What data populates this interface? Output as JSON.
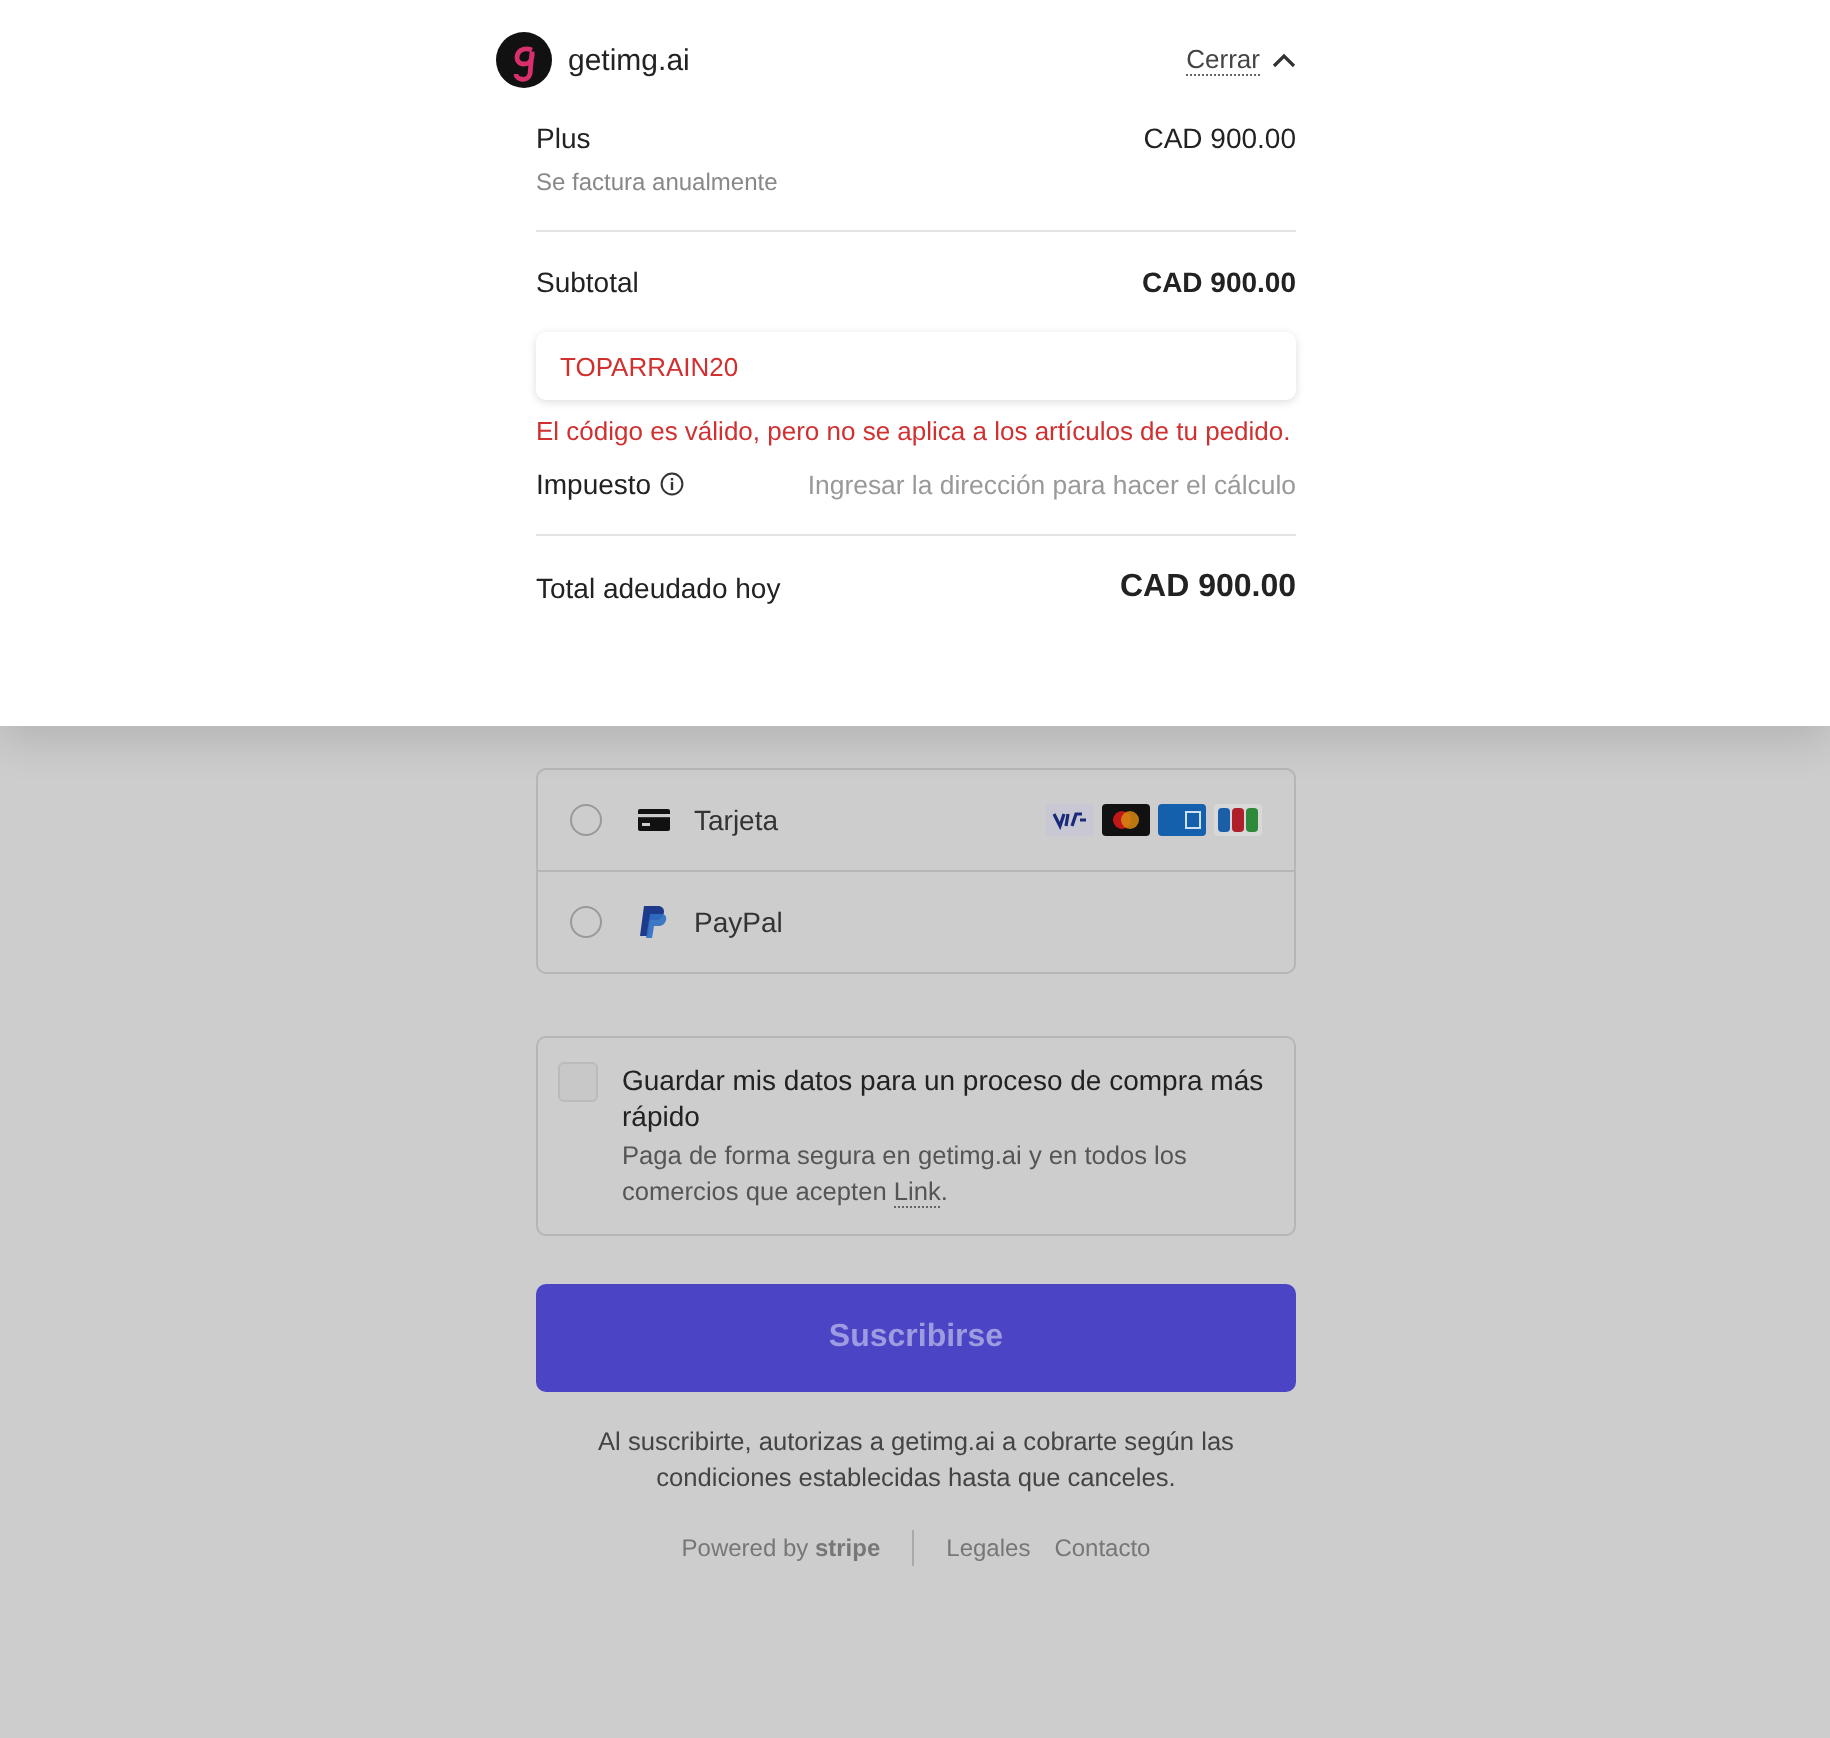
{
  "header": {
    "brand": "getimg.ai",
    "close_label": "Cerrar"
  },
  "line_items": [
    {
      "name": "Plus",
      "note": "Se factura anualmente",
      "amount": "CAD 900.00"
    }
  ],
  "subtotal": {
    "label": "Subtotal",
    "amount": "CAD 900.00"
  },
  "promo": {
    "value": "TOPARRAIN20",
    "error": "El código es válido, pero no se aplica a los artículos de tu pedido."
  },
  "tax": {
    "label": "Impuesto",
    "note": "Ingresar la dirección para hacer el cálculo"
  },
  "total": {
    "label": "Total adeudado hoy",
    "amount": "CAD 900.00"
  },
  "payment_methods": [
    {
      "kind": "card",
      "label": "Tarjeta",
      "selected": false
    },
    {
      "kind": "paypal",
      "label": "PayPal",
      "selected": false
    }
  ],
  "save_info": {
    "checked": false,
    "title": "Guardar mis datos para un proceso de compra más rápido",
    "description": "Paga de forma segura en getimg.ai y en todos los comercios que acepten",
    "link": "Link",
    "after": "."
  },
  "submit": {
    "label": "Suscribirse"
  },
  "terms": "Al suscribirte, autorizas a getimg.ai a cobrarte según las condiciones establecidas hasta que canceles.",
  "footer": {
    "powered_by": "Powered by **stripe**",
    "links": [
      "Legales",
      "Contacto"
    ]
  }
}
